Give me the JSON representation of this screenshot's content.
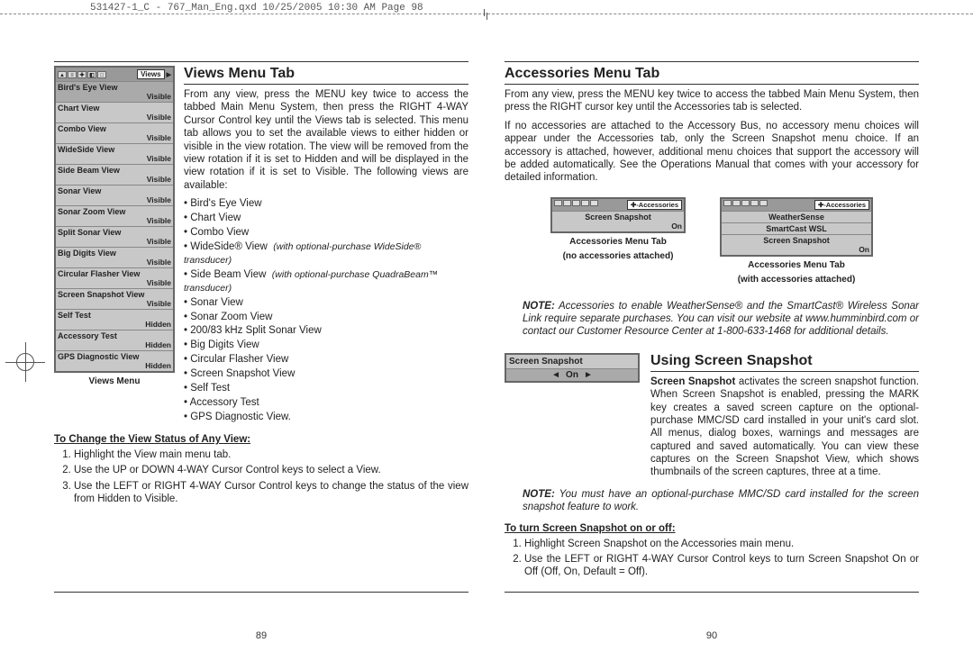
{
  "crop_line": "531427-1_C - 767_Man_Eng.qxd  10/25/2005  10:30 AM  Page 98",
  "left_page": {
    "heading": "Views Menu Tab",
    "intro": "From any view, press the MENU key twice to access the tabbed Main Menu System, then press the RIGHT 4-WAY Cursor Control key until the Views tab is selected. This menu tab allows you to set the available views to either hidden or visible in the view rotation.  The view will be removed from the view rotation if it is set to Hidden and will be displayed in the view rotation if it is set to Visible. The following views are available:",
    "views_tab_label": "Views",
    "views_items": [
      {
        "name": "Bird's Eye View",
        "value": "Visible"
      },
      {
        "name": "Chart View",
        "value": "Visible"
      },
      {
        "name": "Combo View",
        "value": "Visible"
      },
      {
        "name": "WideSide View",
        "value": "Visible"
      },
      {
        "name": "Side Beam View",
        "value": "Visible"
      },
      {
        "name": "Sonar View",
        "value": "Visible"
      },
      {
        "name": "Sonar Zoom View",
        "value": "Visible"
      },
      {
        "name": "Split Sonar View",
        "value": "Visible"
      },
      {
        "name": "Big Digits View",
        "value": "Visible"
      },
      {
        "name": "Circular Flasher View",
        "value": "Visible"
      },
      {
        "name": "Screen Snapshot View",
        "value": "Visible"
      },
      {
        "name": "Self Test",
        "value": "Hidden"
      },
      {
        "name": "Accessory Test",
        "value": "Hidden"
      },
      {
        "name": "GPS Diagnostic View",
        "value": "Hidden"
      }
    ],
    "views_caption": "Views Menu",
    "bullets": [
      "Bird's Eye View",
      "Chart View",
      "Combo View"
    ],
    "bullet_ws": "WideSide® View",
    "bullet_ws_note": "(with optional-purchase WideSide® transducer)",
    "bullet_sb": "Side Beam View",
    "bullet_sb_note": "(with optional-purchase QuadraBeam™ transducer)",
    "bullets2": [
      "Sonar View",
      "Sonar Zoom View",
      "200/83 kHz Split Sonar View",
      "Big Digits View",
      "Circular Flasher View",
      "Screen Snapshot View",
      "Self Test",
      "Accessory Test",
      "GPS Diagnostic View."
    ],
    "subhead": "To Change the View Status of Any View:",
    "steps": [
      "Highlight the View main menu tab.",
      "Use the UP or DOWN 4-WAY Cursor Control keys to select a View.",
      "Use the LEFT or RIGHT 4-WAY Cursor Control keys to change the status of the view from Hidden to Visible."
    ],
    "page_num": "89"
  },
  "right_page": {
    "heading_a": "Accessories Menu Tab",
    "para_a1": "From any view, press the MENU key twice to access the tabbed Main Menu System, then press the RIGHT cursor key until the Accessories tab is selected.",
    "para_a2": "If no accessories are attached to the Accessory Bus, no accessory menu choices will appear under the Accessories tab, only the Screen Snapshot menu choice.  If an accessory is attached, however, additional menu choices that support the accessory will be added automatically.  See the Operations Manual that comes with your accessory for detailed information.",
    "acc_tab_label": "Accessories",
    "acc_menu1": {
      "items": [
        {
          "name": "Screen Snapshot",
          "value": "On"
        }
      ],
      "caption1": "Accessories Menu Tab",
      "caption2": "(no accessories attached)"
    },
    "acc_menu2": {
      "items": [
        {
          "name": "WeatherSense",
          "value": ""
        },
        {
          "name": "SmartCast WSL",
          "value": ""
        },
        {
          "name": "Screen Snapshot",
          "value": "On"
        }
      ],
      "caption1": "Accessories Menu Tab",
      "caption2": "(with accessories attached)"
    },
    "note_a_label": "NOTE:",
    "note_a": "Accessories to enable WeatherSense® and the SmartCast® Wireless Sonar Link require separate purchases.  You can visit our website at www.humminbird.com or contact our Customer Resource Center at 1-800-633-1468 for additional details.",
    "heading_b": "Using Screen Snapshot",
    "snapshot_menu": {
      "title": "Screen Snapshot",
      "value": "On",
      "left": "◄",
      "right": "►"
    },
    "para_b_lead": "Screen Snapshot",
    "para_b_rest": " activates the screen snapshot function. When Screen Snapshot is enabled, pressing the MARK key creates a saved screen capture on the optional-purchase MMC/SD card installed in your unit's card slot. All menus, dialog boxes, warnings and messages are captured and saved automatically. You can view these captures on the Screen Snapshot View, which shows thumbnails of the screen captures, three at a time.",
    "note_b_label": "NOTE:",
    "note_b": "You must have an optional-purchase MMC/SD card installed for the screen snapshot feature to work.",
    "subhead_b": "To turn Screen Snapshot on or off:",
    "steps_b": [
      "Highlight Screen Snapshot on the Accessories main menu.",
      "Use the LEFT or RIGHT 4-WAY Cursor Control keys to turn Screen Snapshot On or Off (Off, On, Default = Off)."
    ],
    "page_num": "90"
  }
}
